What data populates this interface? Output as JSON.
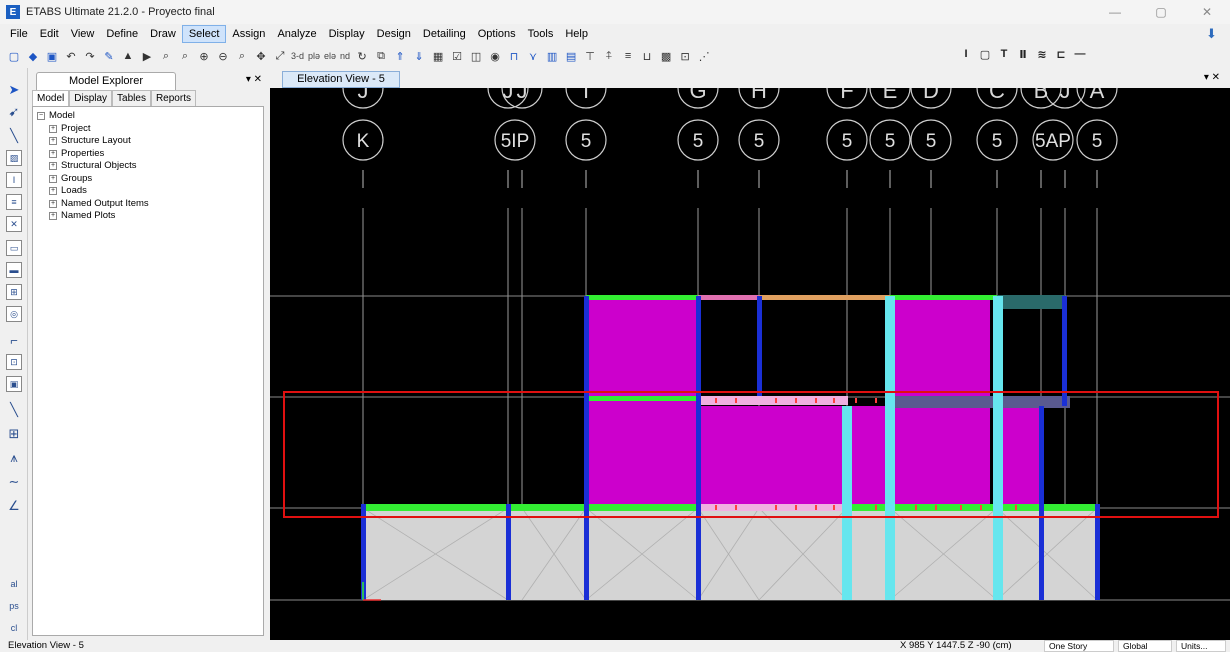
{
  "window": {
    "app_icon_letter": "E",
    "title": "ETABS Ultimate 21.2.0 - Proyecto final",
    "controls": [
      "—",
      "▢",
      "✕"
    ]
  },
  "menu": {
    "items": [
      "File",
      "Edit",
      "View",
      "Define",
      "Draw",
      "Select",
      "Assign",
      "Analyze",
      "Display",
      "Design",
      "Detailing",
      "Options",
      "Tools",
      "Help"
    ],
    "active": "Select"
  },
  "toolbar": {
    "text_3d": "3-d",
    "text_plan": "plǝ",
    "text_elev": "elǝ",
    "text_nd": "nd"
  },
  "model_explorer": {
    "title": "Model Explorer",
    "controls": "▾ ✕",
    "tabs": [
      "Model",
      "Display",
      "Tables",
      "Reports"
    ],
    "root": "Model",
    "children": [
      "Project",
      "Structure Layout",
      "Properties",
      "Structural Objects",
      "Groups",
      "Loads",
      "Named Output Items",
      "Named Plots"
    ]
  },
  "view": {
    "tab_label": "Elevation View - 5",
    "close_label": "▾ ✕",
    "gridline_bubbles_top": [
      "J",
      "J",
      "J",
      "I",
      "G",
      "H",
      "F",
      "E",
      "D",
      "C",
      "B",
      "J",
      "A"
    ],
    "gridline_bubbles": [
      "K",
      "5IP",
      "5",
      "5",
      "5",
      "5",
      "5",
      "5",
      "5",
      "5AP",
      "5"
    ]
  },
  "status": {
    "view_name": "Elevation View - 5",
    "coordinates": "X 985  Y 1447.5  Z -90 (cm)",
    "story_select": "One Story",
    "coord_system": "Global",
    "units": "Units..."
  },
  "colors": {
    "slab_fill": "#cc00cc",
    "beam_green": "#33ee33",
    "column_blue": "#1a2fd6",
    "column_cyan": "#66e6ee",
    "selection_red": "#e01010",
    "ground_fill": "#d4d4d4"
  }
}
